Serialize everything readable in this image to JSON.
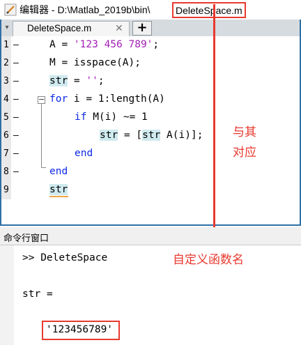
{
  "titlebar": {
    "app_label": "编辑器 - D:\\Matlab_2019b\\bin\\",
    "file_name": "DeleteSpace.m"
  },
  "tabs": [
    {
      "label": "DeleteSpace.m",
      "close": "✕"
    }
  ],
  "tab_add_label": "+",
  "editor": {
    "line_numbers": [
      "1",
      "2",
      "3",
      "4",
      "5",
      "6",
      "7",
      "8",
      "9"
    ],
    "dashes": [
      "—",
      "—",
      "—",
      "—",
      "—",
      "—",
      "—",
      "—"
    ],
    "lines": {
      "l1_a": "A = ",
      "l1_str": "'123 456 789'",
      "l1_end": ";",
      "l2": "M = isspace(A);",
      "l3_var": "str",
      "l3_rest": " = ",
      "l3_str": "''",
      "l3_end": ";",
      "l4_kw": "for",
      "l4_rest": " i = 1:length(A)",
      "l5_kw": "if",
      "l5_rest": " M(i) ~= 1",
      "l6_var": "str",
      "l6_mid": " = [",
      "l6_var2": "str",
      "l6_rest": " A(i)];",
      "l7_kw": "end",
      "l8_kw": "end",
      "l9_var": "str"
    },
    "fold_symbol": "−"
  },
  "annotations": {
    "correspond_line1": "与其",
    "correspond_line2": "对应",
    "custom_function_name": "自定义函数名"
  },
  "command_window": {
    "title": "命令行窗口",
    "prompt_line": ">> DeleteSpace",
    "output_var": "str =",
    "output_value": "'123456789'"
  },
  "colors": {
    "keyword": "#0b28e8",
    "string": "#a31eb5",
    "annotation_red": "#e8392f",
    "editor_frame": "#2f6fa6"
  }
}
